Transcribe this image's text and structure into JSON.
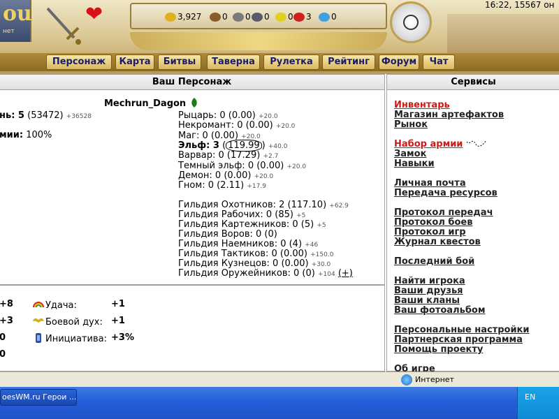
{
  "header": {
    "logo_text": "ou",
    "logo_sub": "нет",
    "time_text": "16:22, 15567 он",
    "resources": [
      {
        "name": "gold",
        "value": "3,927",
        "color": "#e0b020"
      },
      {
        "name": "wood",
        "value": "0",
        "color": "#8b5a2b"
      },
      {
        "name": "ore",
        "value": "0",
        "color": "#7a7a7a"
      },
      {
        "name": "mercury",
        "value": "0",
        "color": "#5a5a6a"
      },
      {
        "name": "sulfur",
        "value": "0",
        "color": "#e0d020"
      },
      {
        "name": "crystals",
        "value": "3",
        "color": "#d02020"
      },
      {
        "name": "gems",
        "value": "0",
        "color": "#40a0e0"
      }
    ]
  },
  "nav": [
    "Персонаж",
    "Карта",
    "Битвы",
    "Таверна",
    "Рулетка",
    "Рейтинг",
    "Форум",
    "Чат"
  ],
  "character": {
    "panel_title": "Ваш Персонаж",
    "name": "Mechrun_Dagon",
    "level_label": "нь: 5",
    "level_value": "(53472)",
    "level_bonus": "+36528",
    "army_label": "мии:",
    "army_value": "100%",
    "factions": [
      {
        "label": "Рыцарь: 0 (0.00)",
        "bonus": "+20.0",
        "bold": false
      },
      {
        "label": "Некромант: 0 (0.00)",
        "bonus": "+20.0",
        "bold": false
      },
      {
        "label": "Маг: 0 (0.00)",
        "bonus": "+20.0",
        "bold": false
      },
      {
        "label": "Эльф: 3",
        "extra": "119.99",
        "bonus": "+40.0",
        "bold": true
      },
      {
        "label": "Варвар: 0 (17.29)",
        "bonus": "+2.7",
        "bold": false
      },
      {
        "label": "Темный эльф: 0 (0.00)",
        "bonus": "+20.0",
        "bold": false
      },
      {
        "label": "Демон: 0 (0.00)",
        "bonus": "+20.0",
        "bold": false
      },
      {
        "label": "Гном: 0 (2.11)",
        "bonus": "+17.9",
        "bold": false
      }
    ],
    "guilds": [
      {
        "label": "Гильдия Охотников: 2 (117.10)",
        "bonus": "+62.9"
      },
      {
        "label": "Гильдия Рабочих: 0 (85)",
        "bonus": "+5"
      },
      {
        "label": "Гильдия Картежников: 0 (5)",
        "bonus": "+5"
      },
      {
        "label": "Гильдия Воров: 0 (0)",
        "bonus": ""
      },
      {
        "label": "Гильдия Наемников: 0 (4)",
        "bonus": "+46"
      },
      {
        "label": "Гильдия Тактиков: 0 (0.00)",
        "bonus": "+150.0"
      },
      {
        "label": "Гильдия Кузнецов: 0 (0.00)",
        "bonus": "+30.0"
      },
      {
        "label": "Гильдия Оружейников: 0 (0)",
        "bonus": "+104",
        "plus": "(+)"
      }
    ]
  },
  "stats": {
    "left_values": [
      "+8",
      "+3",
      "0",
      "0"
    ],
    "items": [
      {
        "label": "Удача:",
        "value": "+1"
      },
      {
        "label": "Боевой дух:",
        "value": "+1"
      },
      {
        "label": "Инициатива:",
        "value": "+3%"
      }
    ]
  },
  "services": {
    "panel_title": "Сервисы",
    "links": [
      {
        "label": "Инвентарь",
        "red": true
      },
      {
        "label": "Магазин артефактов",
        "red": false
      },
      {
        "label": "Рынок",
        "red": false
      },
      {
        "label": "Набор армии",
        "red": true
      },
      {
        "label": "Замок",
        "red": false
      },
      {
        "label": "Навыки",
        "red": false
      },
      {
        "label": "Личная почта",
        "red": false
      },
      {
        "label": "Передача ресурсов",
        "red": false
      },
      {
        "label": "Протокол передач",
        "red": false
      },
      {
        "label": "Протокол боев",
        "red": false
      },
      {
        "label": "Протокол игр",
        "red": false
      },
      {
        "label": "Журнал квестов",
        "red": false
      },
      {
        "label": "Последний бой",
        "red": false
      },
      {
        "label": "Найти игрока",
        "red": false
      },
      {
        "label": "Ваши друзья",
        "red": false
      },
      {
        "label": "Ваши кланы",
        "red": false
      },
      {
        "label": "Ваш фотоальбом",
        "red": false
      },
      {
        "label": "Персональные настройки",
        "red": false
      },
      {
        "label": "Партнерская программа",
        "red": false
      },
      {
        "label": "Помощь проекту",
        "red": false
      },
      {
        "label": "Об игре",
        "red": false
      }
    ]
  },
  "browser": {
    "zone_text": "Интернет",
    "task_label": "oesWM.ru Герои ...",
    "lang": "EN"
  }
}
